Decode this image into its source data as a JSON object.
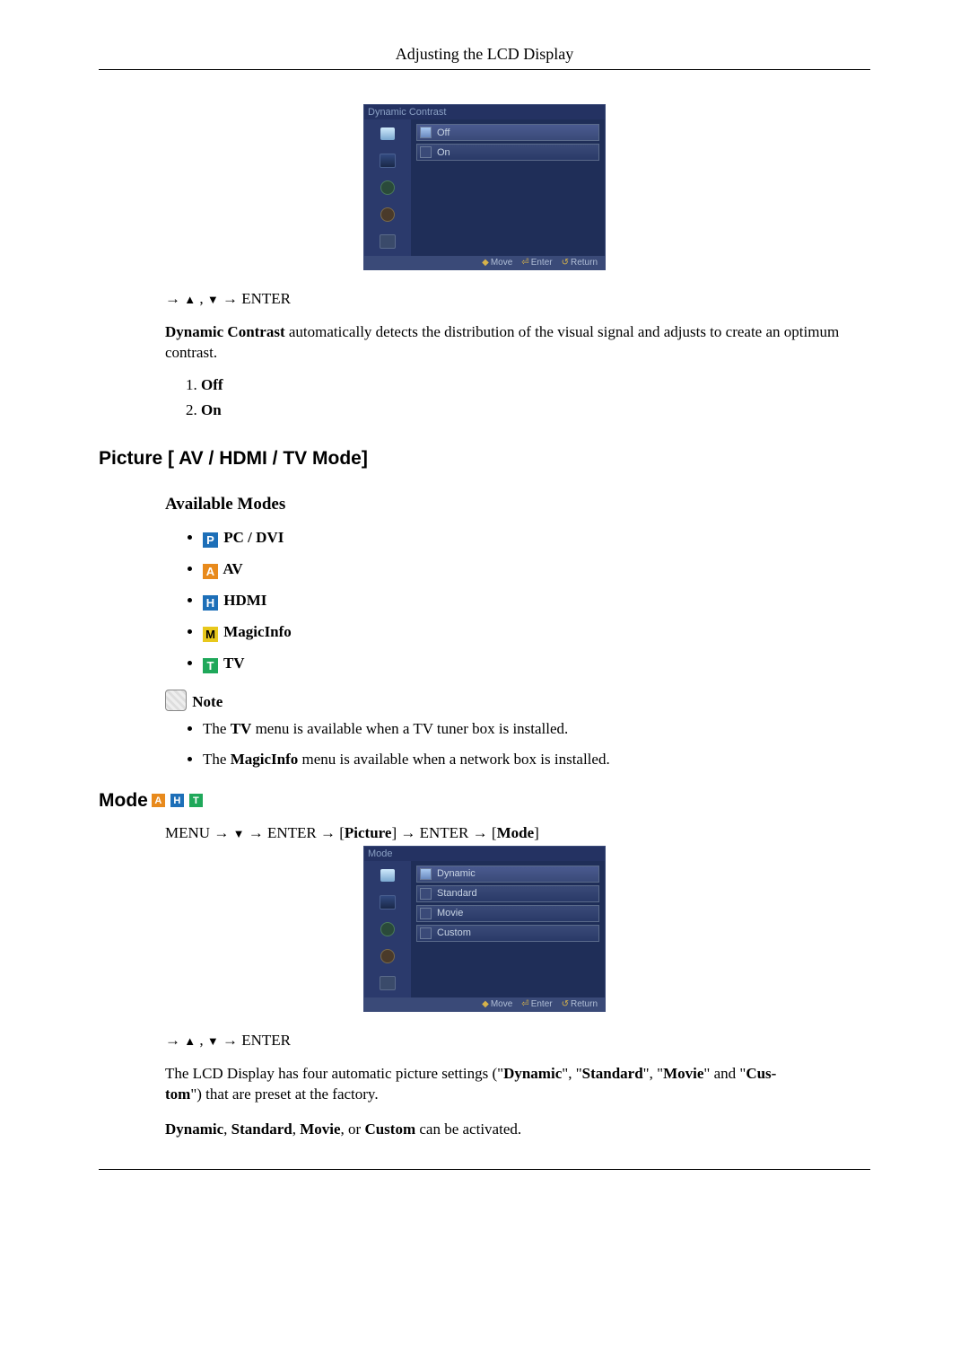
{
  "header": {
    "title": "Adjusting the LCD Display"
  },
  "osd1": {
    "title": "Dynamic Contrast",
    "options": [
      "Off",
      "On"
    ],
    "footer": {
      "move": "Move",
      "enter": "Enter",
      "return": "Return"
    }
  },
  "nav1": {
    "arrow": "→",
    "up": "▲",
    "comma": " , ",
    "down": "▼",
    "arrow2": " → ",
    "enter": "ENTER"
  },
  "dc_para": {
    "lead_bold": "Dynamic Contrast",
    "rest": " automatically detects the distribution of the visual signal and adjusts to create an optimum contrast."
  },
  "dc_list": {
    "i1": "Off",
    "i2": "On"
  },
  "h2_picture": "Picture [ AV / HDMI / TV Mode]",
  "h3_modes": "Available Modes",
  "modes": {
    "p": {
      "letter": "P",
      "label": "PC / DVI"
    },
    "a": {
      "letter": "A",
      "label": "AV"
    },
    "h": {
      "letter": "H",
      "label": "HDMI"
    },
    "m": {
      "letter": "M",
      "label": "MagicInfo"
    },
    "t": {
      "letter": "T",
      "label": "TV"
    }
  },
  "note_label": "Note",
  "notes": {
    "n1_a": "The ",
    "n1_b": "TV",
    "n1_c": " menu is available when a TV tuner box is installed.",
    "n2_a": "The ",
    "n2_b": "MagicInfo",
    "n2_c": " menu is available when a network box is installed."
  },
  "mode_hdr": "Mode",
  "menu_path": {
    "m": "MENU",
    "a1": " → ",
    "d": "▼",
    "a2": " → ",
    "e1": "ENTER",
    "a3": " → [",
    "picture": "Picture",
    "b1": "] → ",
    "e2": "ENTER",
    "a4": " → [",
    "mode": "Mode",
    "b2": "]"
  },
  "osd2": {
    "title": "Mode",
    "options": [
      "Dynamic",
      "Standard",
      "Movie",
      "Custom"
    ],
    "footer": {
      "move": "Move",
      "enter": "Enter",
      "return": "Return"
    }
  },
  "nav2": {
    "arrow": "→",
    "up": "▲",
    "comma": " , ",
    "down": "▼",
    "arrow2": " → ",
    "enter": "ENTER"
  },
  "mode_para": {
    "a": "The LCD Display has four automatic picture settings (\"",
    "d": "Dynamic",
    "s1": "\", \"",
    "s": "Standard",
    "s2": "\", \"",
    "mv": "Movie",
    "s3": "\" and \"",
    "c": "Cus-",
    "c2": "tom",
    "b": "\") that are preset at the factory."
  },
  "mode_line2": {
    "d": "Dynamic",
    "c1": ", ",
    "s": "Standard",
    "c2": ", ",
    "m": "Movie",
    "or": ", or ",
    "cu": "Custom",
    "t": " can be activated."
  }
}
